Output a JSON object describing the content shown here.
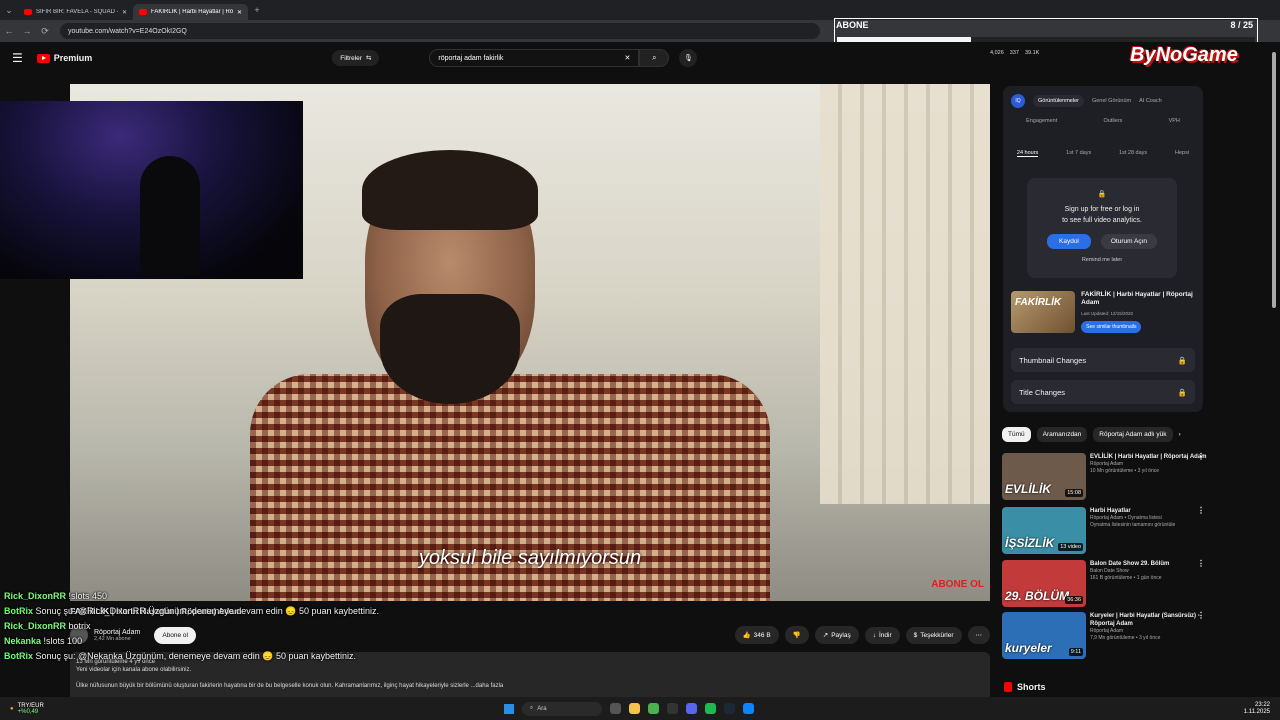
{
  "browser": {
    "tabs": [
      {
        "label": "SIFIR BİR: FAVELA - SQUAD - Yo",
        "active": false
      },
      {
        "label": "FAKİRLİK | Harbi Hayatlar | Rö",
        "active": true
      }
    ],
    "url": "youtube.com/watch?v=E24OzOkI2GQ"
  },
  "header": {
    "logo": "Premium",
    "filters_label": "Filtreler",
    "search_value": "röportaj adam fakirlik",
    "stats": [
      "4,026",
      "337",
      "39.1K"
    ]
  },
  "overlay": {
    "abone_label": "ABONE",
    "abone_count": "8 / 25",
    "abone_progress": 0.32,
    "brand": "ByNoGame"
  },
  "video": {
    "subtitle": "yoksul bile sayılmıyorsun",
    "watermark": "ABONE OL",
    "title": "FAKİRLİK | Harbi Hayatlar | Röportaj Adam",
    "channel": "Röportaj Adam",
    "subscribers": "2,42 Mn abone",
    "subscribe_label": "Abone ol",
    "likes": "346 B",
    "share_label": "Paylaş",
    "download_label": "İndir",
    "thanks_label": "Teşekkürler",
    "views": "13 Mn görüntüleme  4 yıl önce",
    "desc_line1": "Yeni videolar için kanala abone olabilirsiniz.",
    "desc_line2": "Ülke nüfusunun büyük bir bölümünü oluşturan fakirlerin hayatına bir de bu belgeselle konuk olun. Kahramanlarımız, ilginç hayat hikayeleriyle sizlerle ...daha fazla"
  },
  "chat": [
    {
      "user": "Rick_DixonRR",
      "msg": "!slots 450"
    },
    {
      "user": "BotRix",
      "msg": "Sonuç şu: @Rick_DixonRR Üzgünüm, denemeye devam edin 😞 50 puan kaybettiniz."
    },
    {
      "user": "Rick_DixonRR",
      "msg": "botrix"
    },
    {
      "user": "Nekanka",
      "msg": "!slots 100"
    },
    {
      "user": "BotRix",
      "msg": "Sonuç şu: @Nekanka Üzgünüm, denemeye devam edin 😞 50 puan kaybettiniz."
    }
  ],
  "sidebar": {
    "tabs": [
      "Görüntülenmeler",
      "Genel Görünüm",
      "AI Coach"
    ],
    "metrics": [
      "Engagement",
      "Outliers",
      "VPH"
    ],
    "periods": [
      "24 hours",
      "1st 7 days",
      "1st 28 days",
      "Hepsi"
    ],
    "lock_text1": "Sign up for free or log in",
    "lock_text2": "to see full video analytics.",
    "signup": "Kaydol",
    "login": "Oturum Açın",
    "remind": "Remind me later",
    "card_title": "FAKİRLİK | Harbi Hayatlar | Röportaj Adam",
    "card_thumb": "FAKİRLİK",
    "card_updated": "Last Updated: 12/15/2020",
    "card_similar": "See similar thumbnails",
    "thumb_changes": "Thumbnail Changes",
    "title_changes": "Title Changes"
  },
  "chips": [
    "Tümü",
    "Aramanızdan",
    "Röportaj Adam adlı yük"
  ],
  "recommendations": [
    {
      "title": "EVLİLİK | Harbi Hayatlar | Röportaj Adam",
      "channel": "Röportaj Adam",
      "meta": "10 Mn görüntüleme • 3 yıl önce",
      "thumb": "EVLİLİK",
      "dur": "15:08",
      "color": "#6d5a4a"
    },
    {
      "title": "Harbi Hayatlar",
      "channel": "Röportaj Adam • Oynatma listesi",
      "meta": "Oynatma listesinin tamamını görüntüle",
      "thumb": "İŞSİZLİK",
      "dur": "13 video",
      "color": "#3a8fa6"
    },
    {
      "title": "Balon Date Show 29. Bölüm",
      "channel": "Balon Date Show",
      "meta": "161 B görüntüleme • 1 gün önce",
      "thumb": "29. BÖLÜM",
      "dur": "36:36",
      "color": "#c23a3a"
    },
    {
      "title": "Kuryeler | Harbi Hayatlar (Sansürsüz) - Röportaj Adam",
      "channel": "Röportaj Adam",
      "meta": "7,9 Mn görüntüleme • 3 yıl önce",
      "thumb": "kuryeler",
      "dur": "9:11",
      "color": "#2d6fb6"
    }
  ],
  "shorts_label": "Shorts",
  "taskbar": {
    "pair": "TRY/EUR",
    "change": "+%0,49",
    "search": "Ara",
    "time": "23:22",
    "date": "1.11.2025"
  }
}
